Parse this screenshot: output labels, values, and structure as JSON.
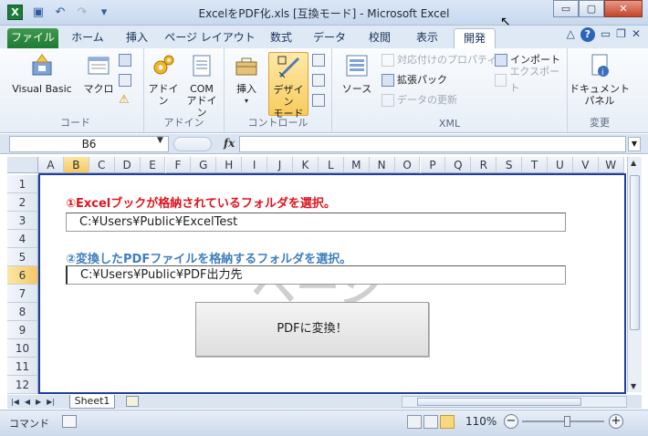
{
  "window": {
    "title": "ExcelをPDF化.xls  [互換モード] - Microsoft Excel",
    "app_icon_letter": "X",
    "minimize": "▭",
    "maximize": "▢",
    "close": "✕"
  },
  "qat": {
    "save": "▣",
    "undo": "↶",
    "redo": "↷",
    "customize": "▾"
  },
  "tabs": {
    "file": "ファイル",
    "home": "ホーム",
    "insert": "挿入",
    "page_layout": "ページ レイアウト",
    "formulas": "数式",
    "data": "データ",
    "review": "校閲",
    "view": "表示",
    "developer": "開発",
    "help": "?"
  },
  "ribbon": {
    "code": {
      "label": "コード",
      "visual_basic": "Visual Basic",
      "macro": "マクロ"
    },
    "addins": {
      "label": "アドイン",
      "addin": "アドイン",
      "com_addin_1": "COM",
      "com_addin_2": "アドイン"
    },
    "controls": {
      "label": "コントロール",
      "insert": "挿入",
      "design_1": "デザイン",
      "design_2": "モード"
    },
    "xml": {
      "label": "XML",
      "source": "ソース",
      "map_properties": "対応付けのプロパティ",
      "expansion_packs": "拡張パック",
      "refresh_data": "データの更新",
      "import": "インポート",
      "export": "エクスポート"
    },
    "modify": {
      "label": "変更",
      "doc_panel_1": "ドキュメント",
      "doc_panel_2": "パネル"
    }
  },
  "formula_bar": {
    "name_box": "B6",
    "fx": "fx",
    "formula": ""
  },
  "columns": [
    "A",
    "B",
    "C",
    "D",
    "E",
    "F",
    "G",
    "H",
    "I",
    "J",
    "K",
    "L",
    "M",
    "N",
    "O",
    "P",
    "Q",
    "R",
    "S",
    "T",
    "U",
    "V",
    "W"
  ],
  "selected_column": "B",
  "rows": [
    "1",
    "2",
    "3",
    "4",
    "5",
    "6",
    "7",
    "8",
    "9",
    "10",
    "11",
    "12"
  ],
  "selected_row": "6",
  "sheet": {
    "label1": "①Excelブックが格納されているフォルダを選択。",
    "input1": "C:¥Users¥Public¥ExcelTest",
    "label2": "②変換したPDFファイルを格納するフォルダを選択。",
    "input2": "C:¥Users¥Public¥PDF出力先",
    "convert_button": "PDFに変換！",
    "watermark": "ページ"
  },
  "sheet_tabs": {
    "nav": [
      "|◀",
      "◀",
      "▶",
      "▶|"
    ],
    "sheet1": "Sheet1"
  },
  "status": {
    "mode": "コマンド",
    "zoom": "110%",
    "zoom_minus": "−",
    "zoom_plus": "+",
    "zoom_level": 0.55
  },
  "colors": {
    "label1": "#e0141e",
    "label2": "#3f7fbf",
    "file_tab": "#1f7a33",
    "selection_border": "#1f3e9e"
  }
}
